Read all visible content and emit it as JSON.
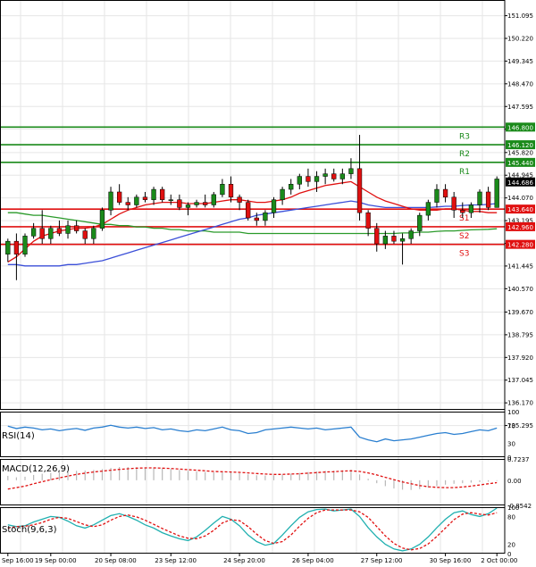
{
  "chart_data": {
    "type": "candlestick",
    "main": {
      "ylim": [
        135.9,
        151.7
      ],
      "price_ticks": [
        "151.095",
        "150.220",
        "149.345",
        "148.470",
        "147.595",
        "146.720",
        "145.820",
        "144.945",
        "144.070",
        "143.195",
        "142.320",
        "141.445",
        "140.570",
        "139.670",
        "138.795",
        "137.920",
        "137.045",
        "136.170",
        "135.295"
      ],
      "current_price": "144.686",
      "levels": [
        {
          "name": "R3",
          "value": 146.8,
          "label": "146.800",
          "color": "#1a8a1a"
        },
        {
          "name": "R2",
          "value": 146.12,
          "label": "146.120",
          "color": "#1a8a1a"
        },
        {
          "name": "R1",
          "value": 145.44,
          "label": "145.440",
          "color": "#1a8a1a"
        },
        {
          "name": "S1",
          "value": 143.64,
          "label": "143.640",
          "color": "#e01010"
        },
        {
          "name": "S2",
          "value": 142.96,
          "label": "142.960",
          "color": "#e01010"
        },
        {
          "name": "S3",
          "value": 142.28,
          "label": "142.280",
          "color": "#e01010"
        }
      ],
      "candles": [
        [
          141.9,
          142.5,
          141.6,
          142.4
        ],
        [
          142.4,
          142.7,
          140.9,
          141.9
        ],
        [
          141.9,
          142.7,
          141.8,
          142.6
        ],
        [
          142.6,
          143.1,
          142.5,
          142.9
        ],
        [
          142.9,
          143.6,
          142.3,
          142.5
        ],
        [
          142.5,
          143.0,
          142.3,
          142.9
        ],
        [
          142.9,
          143.2,
          142.6,
          142.7
        ],
        [
          142.7,
          143.2,
          142.5,
          143.0
        ],
        [
          143.0,
          143.2,
          142.7,
          142.8
        ],
        [
          142.8,
          142.9,
          142.3,
          142.5
        ],
        [
          142.5,
          143.0,
          142.3,
          142.9
        ],
        [
          142.9,
          143.7,
          142.8,
          143.6
        ],
        [
          143.6,
          144.5,
          143.4,
          144.3
        ],
        [
          144.3,
          144.6,
          143.8,
          143.9
        ],
        [
          143.9,
          144.1,
          143.6,
          143.8
        ],
        [
          143.8,
          144.2,
          143.7,
          144.1
        ],
        [
          144.1,
          144.3,
          143.9,
          144.0
        ],
        [
          144.0,
          144.5,
          143.8,
          144.4
        ],
        [
          144.4,
          144.5,
          143.9,
          144.0
        ],
        [
          144.0,
          144.2,
          143.8,
          144.0
        ],
        [
          144.0,
          144.2,
          143.6,
          143.7
        ],
        [
          143.7,
          143.9,
          143.4,
          143.8
        ],
        [
          143.8,
          144.0,
          143.7,
          143.9
        ],
        [
          143.9,
          144.2,
          143.7,
          143.8
        ],
        [
          143.8,
          144.3,
          143.7,
          144.2
        ],
        [
          144.2,
          144.8,
          144.1,
          144.6
        ],
        [
          144.6,
          144.9,
          143.9,
          144.1
        ],
        [
          144.1,
          144.2,
          143.6,
          143.9
        ],
        [
          143.9,
          144.0,
          143.2,
          143.3
        ],
        [
          143.3,
          143.5,
          143.0,
          143.2
        ],
        [
          143.2,
          143.6,
          143.0,
          143.5
        ],
        [
          143.5,
          144.1,
          143.3,
          144.0
        ],
        [
          144.0,
          144.5,
          143.8,
          144.4
        ],
        [
          144.4,
          144.8,
          144.2,
          144.6
        ],
        [
          144.6,
          145.0,
          144.4,
          144.9
        ],
        [
          144.9,
          145.2,
          144.5,
          144.7
        ],
        [
          144.7,
          145.1,
          144.3,
          144.9
        ],
        [
          144.9,
          145.2,
          144.6,
          145.0
        ],
        [
          145.0,
          145.2,
          144.7,
          144.8
        ],
        [
          144.8,
          145.2,
          144.6,
          145.0
        ],
        [
          145.0,
          145.6,
          144.8,
          145.2
        ],
        [
          145.2,
          146.5,
          143.2,
          143.5
        ],
        [
          143.5,
          143.6,
          142.6,
          142.9
        ],
        [
          142.9,
          143.1,
          142.0,
          142.3
        ],
        [
          142.3,
          142.8,
          142.1,
          142.6
        ],
        [
          142.6,
          142.8,
          142.3,
          142.4
        ],
        [
          142.4,
          142.7,
          141.5,
          142.5
        ],
        [
          142.5,
          142.9,
          142.3,
          142.8
        ],
        [
          142.8,
          143.5,
          142.6,
          143.4
        ],
        [
          143.4,
          144.0,
          143.2,
          143.9
        ],
        [
          143.9,
          144.6,
          143.7,
          144.4
        ],
        [
          144.4,
          144.6,
          143.9,
          144.1
        ],
        [
          144.1,
          144.3,
          143.3,
          143.6
        ],
        [
          143.6,
          143.9,
          143.3,
          143.5
        ],
        [
          143.5,
          143.9,
          143.3,
          143.8
        ],
        [
          143.8,
          144.4,
          143.5,
          144.3
        ],
        [
          144.3,
          144.5,
          143.6,
          143.7
        ],
        [
          143.7,
          144.9,
          143.7,
          144.8
        ]
      ],
      "ma_red": [
        141.6,
        141.8,
        142.1,
        142.4,
        142.6,
        142.7,
        142.8,
        142.85,
        142.9,
        142.9,
        142.95,
        143.05,
        143.25,
        143.45,
        143.6,
        143.7,
        143.8,
        143.85,
        143.9,
        143.9,
        143.9,
        143.85,
        143.85,
        143.85,
        143.9,
        143.95,
        144.0,
        144.0,
        143.95,
        143.9,
        143.9,
        143.95,
        144.0,
        144.1,
        144.25,
        144.35,
        144.45,
        144.55,
        144.6,
        144.65,
        144.7,
        144.5,
        144.3,
        144.1,
        143.95,
        143.85,
        143.75,
        143.65,
        143.6,
        143.6,
        143.6,
        143.65,
        143.65,
        143.6,
        143.55,
        143.55,
        143.5,
        143.5
      ],
      "ma_blue": [
        141.5,
        141.5,
        141.45,
        141.45,
        141.45,
        141.45,
        141.45,
        141.5,
        141.5,
        141.55,
        141.6,
        141.65,
        141.75,
        141.85,
        141.95,
        142.05,
        142.15,
        142.25,
        142.35,
        142.45,
        142.55,
        142.65,
        142.75,
        142.85,
        142.95,
        143.05,
        143.15,
        143.25,
        143.3,
        143.4,
        143.45,
        143.5,
        143.55,
        143.6,
        143.65,
        143.7,
        143.75,
        143.8,
        143.85,
        143.9,
        143.95,
        143.9,
        143.8,
        143.75,
        143.7,
        143.7,
        143.7,
        143.7,
        143.7,
        143.7,
        143.72,
        143.75,
        143.75,
        143.78,
        143.8,
        143.8,
        143.82,
        143.85
      ],
      "ma_green": [
        143.5,
        143.5,
        143.45,
        143.4,
        143.4,
        143.35,
        143.3,
        143.25,
        143.2,
        143.15,
        143.1,
        143.05,
        143.05,
        143.0,
        143.0,
        142.95,
        142.95,
        142.9,
        142.9,
        142.85,
        142.85,
        142.8,
        142.8,
        142.8,
        142.75,
        142.75,
        142.75,
        142.75,
        142.7,
        142.7,
        142.7,
        142.7,
        142.7,
        142.7,
        142.7,
        142.7,
        142.7,
        142.7,
        142.7,
        142.7,
        142.7,
        142.7,
        142.7,
        142.7,
        142.7,
        142.7,
        142.72,
        142.72,
        142.75,
        142.75,
        142.78,
        142.8,
        142.8,
        142.82,
        142.84,
        142.85,
        142.86,
        142.88
      ]
    },
    "rsi": {
      "label": "RSI(14)",
      "ticks": [
        "100",
        "70",
        "30",
        "0"
      ],
      "ylim": [
        0,
        100
      ],
      "values": [
        68,
        63,
        66,
        64,
        60,
        62,
        58,
        61,
        63,
        59,
        64,
        66,
        70,
        66,
        64,
        66,
        63,
        65,
        60,
        62,
        58,
        56,
        60,
        58,
        62,
        66,
        60,
        58,
        52,
        54,
        60,
        62,
        64,
        66,
        64,
        62,
        64,
        60,
        62,
        64,
        66,
        44,
        38,
        34,
        40,
        36,
        38,
        40,
        44,
        48,
        52,
        54,
        50,
        52,
        56,
        60,
        58,
        64
      ]
    },
    "macd": {
      "label": "MACD(12,26,9)",
      "ticks": [
        "0.7237",
        "0.00",
        "-0.8542"
      ],
      "ylim": [
        -0.8542,
        0.7237
      ],
      "histogram": [
        0.15,
        0.1,
        0.12,
        0.18,
        0.22,
        0.25,
        0.28,
        0.3,
        0.32,
        0.33,
        0.35,
        0.38,
        0.42,
        0.45,
        0.45,
        0.44,
        0.43,
        0.42,
        0.4,
        0.38,
        0.35,
        0.32,
        0.3,
        0.28,
        0.27,
        0.28,
        0.27,
        0.24,
        0.2,
        0.17,
        0.16,
        0.17,
        0.19,
        0.22,
        0.25,
        0.28,
        0.3,
        0.32,
        0.33,
        0.34,
        0.36,
        0.2,
        0.05,
        -0.1,
        -0.2,
        -0.28,
        -0.32,
        -0.33,
        -0.3,
        -0.25,
        -0.2,
        -0.15,
        -0.12,
        -0.1,
        -0.08,
        -0.06,
        -0.05,
        -0.02
      ],
      "signal": [
        -0.3,
        -0.25,
        -0.2,
        -0.12,
        -0.05,
        0.02,
        0.08,
        0.14,
        0.2,
        0.24,
        0.28,
        0.31,
        0.34,
        0.37,
        0.39,
        0.41,
        0.42,
        0.42,
        0.41,
        0.4,
        0.38,
        0.36,
        0.34,
        0.32,
        0.3,
        0.29,
        0.28,
        0.27,
        0.25,
        0.23,
        0.21,
        0.2,
        0.2,
        0.21,
        0.22,
        0.24,
        0.26,
        0.28,
        0.29,
        0.31,
        0.32,
        0.3,
        0.25,
        0.18,
        0.1,
        0.02,
        -0.06,
        -0.12,
        -0.18,
        -0.22,
        -0.24,
        -0.25,
        -0.25,
        -0.23,
        -0.2,
        -0.16,
        -0.12,
        -0.08
      ]
    },
    "stoch": {
      "label": "Stoch(9,6,3)",
      "ticks": [
        "100",
        "80",
        "20",
        "0"
      ],
      "ylim": [
        0,
        100
      ],
      "k": [
        62,
        58,
        60,
        68,
        74,
        80,
        78,
        70,
        60,
        55,
        62,
        72,
        82,
        86,
        80,
        72,
        62,
        55,
        45,
        38,
        32,
        28,
        36,
        50,
        66,
        80,
        74,
        60,
        40,
        26,
        18,
        22,
        40,
        60,
        78,
        90,
        95,
        96,
        92,
        94,
        96,
        80,
        56,
        36,
        20,
        10,
        6,
        10,
        20,
        36,
        56,
        74,
        88,
        92,
        84,
        80,
        86,
        98
      ],
      "d": [
        55,
        58,
        59,
        62,
        67,
        74,
        78,
        76,
        69,
        62,
        58,
        62,
        72,
        80,
        83,
        79,
        72,
        63,
        54,
        46,
        38,
        33,
        32,
        38,
        50,
        66,
        73,
        71,
        58,
        42,
        28,
        22,
        26,
        40,
        59,
        76,
        88,
        94,
        94,
        94,
        94,
        90,
        78,
        58,
        38,
        22,
        12,
        8,
        11,
        21,
        37,
        55,
        73,
        85,
        88,
        85,
        83,
        88
      ]
    },
    "x_labels": [
      "18 Sep 16:00",
      "19 Sep 00:00",
      "20 Sep 08:00",
      "23 Sep 12:00",
      "24 Sep 20:00",
      "26 Sep 04:00",
      "27 Sep 12:00",
      "30 Sep 16:00",
      "2 Oct 00:00"
    ],
    "x_label_positions": [
      0,
      5,
      12,
      19,
      27,
      35,
      43,
      51,
      57
    ]
  },
  "colors": {
    "bull": "#1a8a1a",
    "bear": "#e01010",
    "ma_red": "#e01010",
    "ma_blue": "#3b4fd8",
    "ma_green": "#2a9a2a",
    "rsi_line": "#2a7fd0",
    "macd_hist": "#b8b8b8",
    "macd_signal": "#e01010",
    "stoch_k": "#20b0b0",
    "stoch_d": "#e01010",
    "grid": "#e6e6e6",
    "axis": "#000000"
  }
}
